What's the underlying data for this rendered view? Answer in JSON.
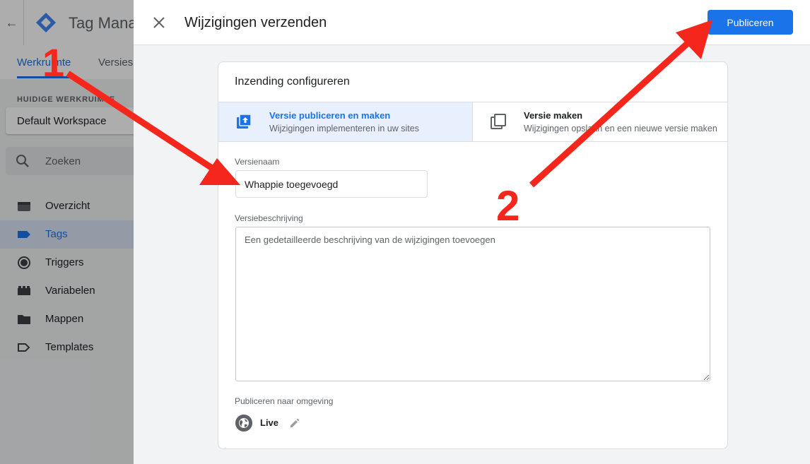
{
  "app": {
    "title": "Tag Mana",
    "tabs": [
      "Werkruimte",
      "Versies"
    ],
    "workspace_heading": "HUIDIGE WERKRUIMTE",
    "workspace_name": "Default Workspace",
    "search_label": "Zoeken",
    "nav": [
      {
        "label": "Overzicht",
        "icon": "overview-icon"
      },
      {
        "label": "Tags",
        "icon": "tag-icon"
      },
      {
        "label": "Triggers",
        "icon": "trigger-icon"
      },
      {
        "label": "Variabelen",
        "icon": "variables-icon"
      },
      {
        "label": "Mappen",
        "icon": "folder-icon"
      },
      {
        "label": "Templates",
        "icon": "template-icon"
      }
    ],
    "active_nav": "Tags"
  },
  "panel": {
    "title": "Wijzigingen verzenden",
    "publish_label": "Publiceren",
    "card_title": "Inzending configureren",
    "options": [
      {
        "title": "Versie publiceren en maken",
        "subtitle": "Wijzigingen implementeren in uw sites",
        "icon": "publish-upload-icon",
        "selected": true
      },
      {
        "title": "Versie maken",
        "subtitle": "Wijzigingen opslaan en een nieuwe versie maken",
        "icon": "copy-version-icon",
        "selected": false
      }
    ],
    "version_name_label": "Versienaam",
    "version_name_value": "Whappie toegevoegd",
    "version_desc_label": "Versiebeschrijving",
    "version_desc_placeholder": "Een gedetailleerde beschrijving van de wijzigingen toevoegen",
    "environment_label": "Publiceren naar omgeving",
    "environment_name": "Live"
  },
  "annotations": {
    "step1": "1",
    "step2": "2",
    "arrow_color": "#f5261c"
  },
  "colors": {
    "accent": "#1a73e8",
    "selected_bg": "#e8f0fe"
  }
}
